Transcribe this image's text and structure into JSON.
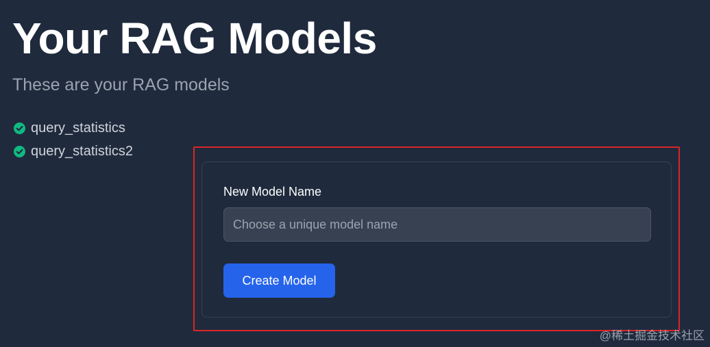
{
  "page": {
    "title": "Your RAG Models",
    "subtitle": "These are your RAG models"
  },
  "models": [
    {
      "name": "query_statistics",
      "icon": "check-circle-icon"
    },
    {
      "name": "query_statistics2",
      "icon": "check-circle-icon"
    }
  ],
  "form": {
    "label": "New Model Name",
    "input_value": "",
    "input_placeholder": "Choose a unique model name",
    "submit_label": "Create Model"
  },
  "watermark": "@稀土掘金技术社区",
  "colors": {
    "background": "#1f2a3d",
    "check": "#10b981",
    "button": "#2563eb",
    "highlight": "#dc2626"
  }
}
